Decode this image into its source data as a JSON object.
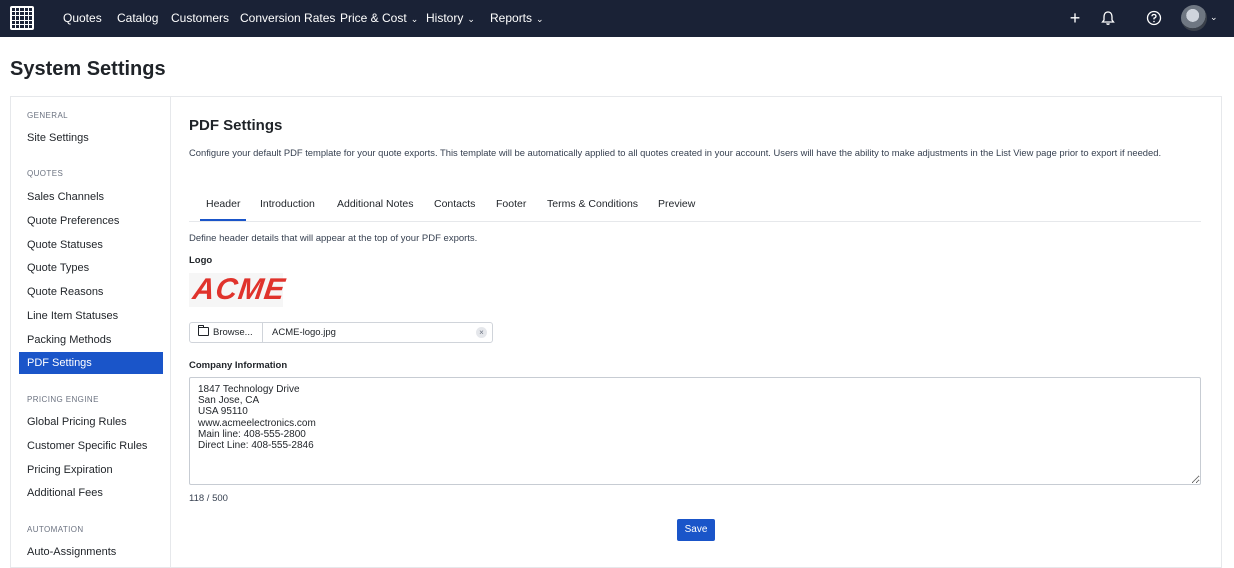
{
  "nav": {
    "items": [
      {
        "label": "Quotes",
        "dropdown": false
      },
      {
        "label": "Catalog",
        "dropdown": false
      },
      {
        "label": "Customers",
        "dropdown": false
      },
      {
        "label": "Conversion Rates",
        "dropdown": false
      },
      {
        "label": "Price & Cost",
        "dropdown": true
      },
      {
        "label": "History",
        "dropdown": true
      },
      {
        "label": "Reports",
        "dropdown": true
      }
    ],
    "right_icons": {
      "add": "+",
      "bell": "bell-icon",
      "help": "?"
    }
  },
  "page": {
    "title": "System Settings"
  },
  "sidebar": {
    "sections": {
      "general": "GENERAL",
      "quotes": "QUOTES",
      "pricing": "PRICING ENGINE",
      "automation": "AUTOMATION"
    },
    "items": {
      "site_settings": "Site Settings",
      "sales_channels": "Sales Channels",
      "quote_preferences": "Quote Preferences",
      "quote_statuses": "Quote Statuses",
      "quote_types": "Quote Types",
      "quote_reasons": "Quote Reasons",
      "line_item_statuses": "Line Item Statuses",
      "packing_methods": "Packing Methods",
      "pdf_settings": "PDF Settings",
      "global_pricing_rules": "Global Pricing Rules",
      "customer_specific_rules": "Customer Specific Rules",
      "pricing_expiration": "Pricing Expiration",
      "additional_fees": "Additional Fees",
      "auto_assignments": "Auto-Assignments"
    },
    "active": "PDF Settings"
  },
  "main": {
    "title": "PDF Settings",
    "description": "Configure your default PDF template for your quote exports. This template will be automatically applied to all quotes created in your account. Users will have the ability to make adjustments in the List View page prior to export if needed.",
    "tabs": {
      "header": "Header",
      "introduction": "Introduction",
      "additional_notes": "Additional Notes",
      "contacts": "Contacts",
      "footer": "Footer",
      "terms": "Terms & Conditions",
      "preview": "Preview"
    },
    "active_tab": "Header",
    "sub_description": "Define header details that will appear at the top of your PDF exports.",
    "logo_label": "Logo",
    "logo_text": "ACME",
    "browse_label": "Browse...",
    "file_name": "ACME-logo.jpg",
    "company_label": "Company Information",
    "company_info": "1847 Technology Drive\nSan Jose, CA\nUSA 95110\nwww.acmeelectronics.com\nMain line: 408-555-2800\nDirect Line: 408-555-2846",
    "char_count": "118 / 500",
    "save_label": "Save"
  },
  "colors": {
    "nav_bg": "#1a2236",
    "accent": "#1a55c9",
    "logo_red": "#e0332c"
  }
}
